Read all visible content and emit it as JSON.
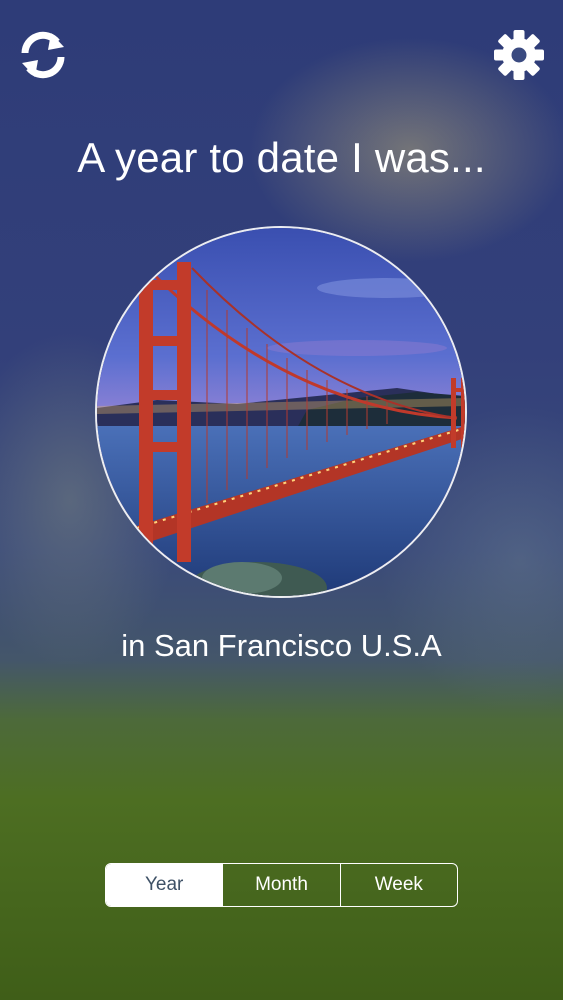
{
  "header": {
    "refresh_icon": "refresh-icon",
    "settings_icon": "gear-icon"
  },
  "main": {
    "headline": "A year to date I was...",
    "photo_subject": "golden-gate-bridge-photo",
    "location": "in San Francisco U.S.A"
  },
  "period_selector": {
    "options": [
      "Year",
      "Month",
      "Week"
    ],
    "selected": "Year"
  },
  "colors": {
    "top_background": "#2e3c78",
    "bottom_background": "#4d6e22",
    "bridge": "#c0392b",
    "text": "#ffffff"
  }
}
